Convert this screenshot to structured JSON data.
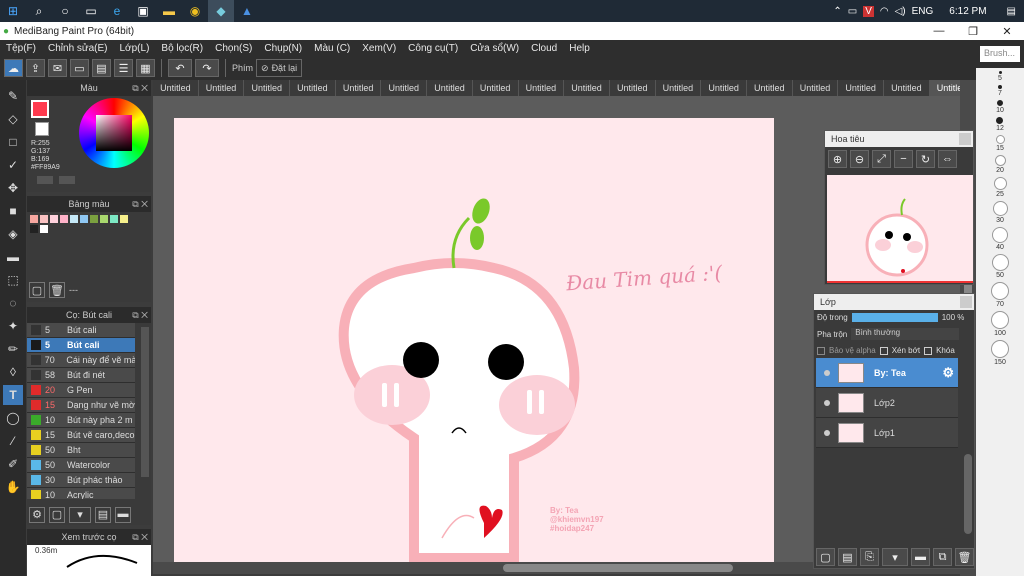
{
  "taskbar": {
    "lang": "ENG",
    "time": "6:12 PM"
  },
  "window": {
    "title": "MediBang Paint Pro (64bit)",
    "minimize": "—",
    "restore": "❐",
    "close": "✕"
  },
  "menu": [
    "Tệp(F)",
    "Chỉnh sửa(E)",
    "Lớp(L)",
    "Bộ lọc(R)",
    "Chọn(S)",
    "Chụp(N)",
    "Màu (C)",
    "Xem(V)",
    "Công cụ(T)",
    "Cửa sổ(W)",
    "Cloud",
    "Help"
  ],
  "toolbar": {
    "phim_label": "Phím",
    "reset_label": "Đặt lại"
  },
  "brush_search_placeholder": "Brush...",
  "color_panel": {
    "title": "Màu",
    "r": "R:255",
    "g": "G:137",
    "b": "B:169",
    "hex": "#FF89A9",
    "primary": "#ff3b4f",
    "secondary": "#ffffff"
  },
  "palette": {
    "title": "Bảng màu",
    "label": "---",
    "swatches": [
      "#f7a7a0",
      "#f9c1c1",
      "#ffd1dc",
      "#ffb2c8",
      "#c5e8f7",
      "#8fc7f2",
      "#7aa03f",
      "#a9d86e",
      "#7de8c4",
      "#f6f08c",
      "#222222",
      "#ffffff"
    ]
  },
  "brush_panel": {
    "title": "Cọ: Bút cali",
    "items": [
      {
        "size": "5",
        "name": "Bút cali",
        "color": "#333333"
      },
      {
        "size": "5",
        "name": "Bút cali",
        "color": "#1a1a1a"
      },
      {
        "size": "70",
        "name": "Cái này để vẽ mà",
        "color": "#333333"
      },
      {
        "size": "58",
        "name": "Bút đi nét",
        "color": "#333333"
      },
      {
        "size": "20",
        "name": "G Pen",
        "color": "#e02b2b"
      },
      {
        "size": "15",
        "name": "Dạng như vẽ mờ",
        "color": "#e02b2b"
      },
      {
        "size": "10",
        "name": "Bút này pha 2 m",
        "color": "#3aaa2a"
      },
      {
        "size": "15",
        "name": "Bút vẽ caro,deco",
        "color": "#e8d020"
      },
      {
        "size": "50",
        "name": "Bht",
        "color": "#e8d020"
      },
      {
        "size": "50",
        "name": "Watercolor",
        "color": "#5ab8e8"
      },
      {
        "size": "30",
        "name": "Bút phác thảo",
        "color": "#5ab8e8"
      },
      {
        "size": "10",
        "name": "Acrylic",
        "color": "#e8d020"
      }
    ]
  },
  "preview_panel": {
    "title": "Xem trước cọ",
    "size": "0.36m"
  },
  "tabs": [
    "Untitled",
    "Untitled",
    "Untitled",
    "Untitled",
    "Untitled",
    "Untitled",
    "Untitled",
    "Untitled",
    "Untitled",
    "Untitled",
    "Untitled",
    "Untitled",
    "Untitled",
    "Untitled",
    "Untitled",
    "Untitled",
    "Untitled",
    "Untitled"
  ],
  "canvas": {
    "handwritten": "Đau Tim quá :'(",
    "credit1": "By: Tea",
    "credit2": "@khiemvn197",
    "credit3": "#hoidap247"
  },
  "navigator": {
    "title": "Hoa tiêu"
  },
  "layers": {
    "title": "Lớp",
    "opacity_label": "Độ trong",
    "opacity_value": "100 %",
    "opacity_level": 1.0,
    "blend_label": "Pha trộn",
    "blend_value": "Bình thường",
    "protect_alpha": "Bảo vệ alpha",
    "clipping": "Xén bớt",
    "lock": "Khóa",
    "items": [
      {
        "name": "By: Tea",
        "selected": true
      },
      {
        "name": "Lớp2",
        "selected": false
      },
      {
        "name": "Lớp1",
        "selected": false
      }
    ]
  },
  "brush_sizes": [
    "5",
    "7",
    "10",
    "12",
    "15",
    "20",
    "25",
    "30",
    "40",
    "50",
    "70",
    "100",
    "150"
  ]
}
